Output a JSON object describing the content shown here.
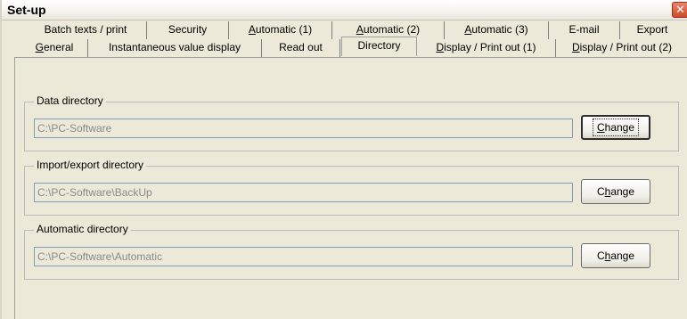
{
  "window": {
    "title": "Set-up",
    "close_glyph": "✕"
  },
  "tabs_row1": [
    {
      "label": "Batch texts / print",
      "mnemonic": ""
    },
    {
      "label": "Security",
      "mnemonic": ""
    },
    {
      "pre": "",
      "mnemonic": "A",
      "post": "utomatic (1)"
    },
    {
      "pre": "",
      "mnemonic": "A",
      "post": "utomatic (2)"
    },
    {
      "pre": "",
      "mnemonic": "A",
      "post": "utomatic (3)"
    },
    {
      "label": "E-mail",
      "mnemonic": ""
    },
    {
      "label": "Export",
      "mnemonic": ""
    }
  ],
  "tabs_row2": [
    {
      "pre": "",
      "mnemonic": "G",
      "post": "eneral"
    },
    {
      "label": "Instantaneous value display"
    },
    {
      "label": "Read out"
    },
    {
      "label": "Directory"
    },
    {
      "pre": "",
      "mnemonic": "D",
      "post": "isplay / Print out (1)"
    },
    {
      "pre": "",
      "mnemonic": "D",
      "post": "isplay / Print out (2)"
    }
  ],
  "active_tab": "Directory",
  "groups": [
    {
      "label": "Data directory",
      "path": "C:\\PC-Software",
      "button": {
        "pre": "",
        "mnemonic": "C",
        "post": "hange"
      },
      "focused": true
    },
    {
      "label": "Import/export directory",
      "path": "C:\\PC-Software\\BackUp",
      "button": {
        "pre": "C",
        "mnemonic": "h",
        "post": "ange"
      },
      "focused": false
    },
    {
      "label": "Automatic directory",
      "path": "C:\\PC-Software\\Automatic",
      "button": {
        "pre": "C",
        "mnemonic": "h",
        "post": "ange"
      },
      "focused": false
    }
  ]
}
